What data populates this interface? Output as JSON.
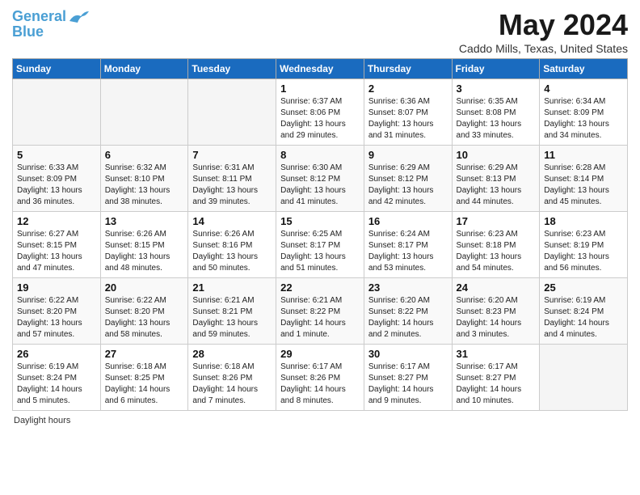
{
  "header": {
    "logo_line1": "General",
    "logo_line2": "Blue",
    "month_title": "May 2024",
    "subtitle": "Caddo Mills, Texas, United States"
  },
  "days_of_week": [
    "Sunday",
    "Monday",
    "Tuesday",
    "Wednesday",
    "Thursday",
    "Friday",
    "Saturday"
  ],
  "weeks": [
    [
      {
        "day": "",
        "info": ""
      },
      {
        "day": "",
        "info": ""
      },
      {
        "day": "",
        "info": ""
      },
      {
        "day": "1",
        "info": "Sunrise: 6:37 AM\nSunset: 8:06 PM\nDaylight: 13 hours\nand 29 minutes."
      },
      {
        "day": "2",
        "info": "Sunrise: 6:36 AM\nSunset: 8:07 PM\nDaylight: 13 hours\nand 31 minutes."
      },
      {
        "day": "3",
        "info": "Sunrise: 6:35 AM\nSunset: 8:08 PM\nDaylight: 13 hours\nand 33 minutes."
      },
      {
        "day": "4",
        "info": "Sunrise: 6:34 AM\nSunset: 8:09 PM\nDaylight: 13 hours\nand 34 minutes."
      }
    ],
    [
      {
        "day": "5",
        "info": "Sunrise: 6:33 AM\nSunset: 8:09 PM\nDaylight: 13 hours\nand 36 minutes."
      },
      {
        "day": "6",
        "info": "Sunrise: 6:32 AM\nSunset: 8:10 PM\nDaylight: 13 hours\nand 38 minutes."
      },
      {
        "day": "7",
        "info": "Sunrise: 6:31 AM\nSunset: 8:11 PM\nDaylight: 13 hours\nand 39 minutes."
      },
      {
        "day": "8",
        "info": "Sunrise: 6:30 AM\nSunset: 8:12 PM\nDaylight: 13 hours\nand 41 minutes."
      },
      {
        "day": "9",
        "info": "Sunrise: 6:29 AM\nSunset: 8:12 PM\nDaylight: 13 hours\nand 42 minutes."
      },
      {
        "day": "10",
        "info": "Sunrise: 6:29 AM\nSunset: 8:13 PM\nDaylight: 13 hours\nand 44 minutes."
      },
      {
        "day": "11",
        "info": "Sunrise: 6:28 AM\nSunset: 8:14 PM\nDaylight: 13 hours\nand 45 minutes."
      }
    ],
    [
      {
        "day": "12",
        "info": "Sunrise: 6:27 AM\nSunset: 8:15 PM\nDaylight: 13 hours\nand 47 minutes."
      },
      {
        "day": "13",
        "info": "Sunrise: 6:26 AM\nSunset: 8:15 PM\nDaylight: 13 hours\nand 48 minutes."
      },
      {
        "day": "14",
        "info": "Sunrise: 6:26 AM\nSunset: 8:16 PM\nDaylight: 13 hours\nand 50 minutes."
      },
      {
        "day": "15",
        "info": "Sunrise: 6:25 AM\nSunset: 8:17 PM\nDaylight: 13 hours\nand 51 minutes."
      },
      {
        "day": "16",
        "info": "Sunrise: 6:24 AM\nSunset: 8:17 PM\nDaylight: 13 hours\nand 53 minutes."
      },
      {
        "day": "17",
        "info": "Sunrise: 6:23 AM\nSunset: 8:18 PM\nDaylight: 13 hours\nand 54 minutes."
      },
      {
        "day": "18",
        "info": "Sunrise: 6:23 AM\nSunset: 8:19 PM\nDaylight: 13 hours\nand 56 minutes."
      }
    ],
    [
      {
        "day": "19",
        "info": "Sunrise: 6:22 AM\nSunset: 8:20 PM\nDaylight: 13 hours\nand 57 minutes."
      },
      {
        "day": "20",
        "info": "Sunrise: 6:22 AM\nSunset: 8:20 PM\nDaylight: 13 hours\nand 58 minutes."
      },
      {
        "day": "21",
        "info": "Sunrise: 6:21 AM\nSunset: 8:21 PM\nDaylight: 13 hours\nand 59 minutes."
      },
      {
        "day": "22",
        "info": "Sunrise: 6:21 AM\nSunset: 8:22 PM\nDaylight: 14 hours\nand 1 minute."
      },
      {
        "day": "23",
        "info": "Sunrise: 6:20 AM\nSunset: 8:22 PM\nDaylight: 14 hours\nand 2 minutes."
      },
      {
        "day": "24",
        "info": "Sunrise: 6:20 AM\nSunset: 8:23 PM\nDaylight: 14 hours\nand 3 minutes."
      },
      {
        "day": "25",
        "info": "Sunrise: 6:19 AM\nSunset: 8:24 PM\nDaylight: 14 hours\nand 4 minutes."
      }
    ],
    [
      {
        "day": "26",
        "info": "Sunrise: 6:19 AM\nSunset: 8:24 PM\nDaylight: 14 hours\nand 5 minutes."
      },
      {
        "day": "27",
        "info": "Sunrise: 6:18 AM\nSunset: 8:25 PM\nDaylight: 14 hours\nand 6 minutes."
      },
      {
        "day": "28",
        "info": "Sunrise: 6:18 AM\nSunset: 8:26 PM\nDaylight: 14 hours\nand 7 minutes."
      },
      {
        "day": "29",
        "info": "Sunrise: 6:17 AM\nSunset: 8:26 PM\nDaylight: 14 hours\nand 8 minutes."
      },
      {
        "day": "30",
        "info": "Sunrise: 6:17 AM\nSunset: 8:27 PM\nDaylight: 14 hours\nand 9 minutes."
      },
      {
        "day": "31",
        "info": "Sunrise: 6:17 AM\nSunset: 8:27 PM\nDaylight: 14 hours\nand 10 minutes."
      },
      {
        "day": "",
        "info": ""
      }
    ]
  ],
  "footer": {
    "label": "Daylight hours"
  }
}
